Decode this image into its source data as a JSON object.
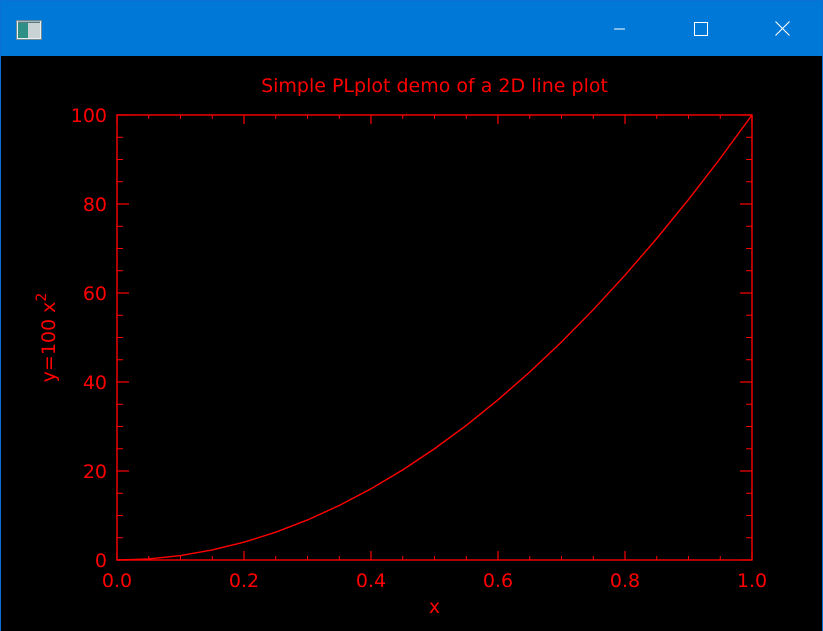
{
  "window": {
    "titlebar_color": "#0078d7",
    "icons": {
      "app": "app-window-icon",
      "minimize": "minimize-icon",
      "maximize": "maximize-icon",
      "close": "close-icon"
    }
  },
  "colors": {
    "plot_background": "#000000",
    "plot_foreground": "#ff0000"
  },
  "chart_data": {
    "type": "line",
    "title": "Simple PLplot demo of a 2D line plot",
    "xlabel": "x",
    "ylabel": "y=100 x",
    "ylabel_superscript": "2",
    "xlim": [
      0.0,
      1.0
    ],
    "ylim": [
      0,
      100
    ],
    "x_ticks": [
      "0.0",
      "0.2",
      "0.4",
      "0.6",
      "0.8",
      "1.0"
    ],
    "x_tick_values": [
      0.0,
      0.2,
      0.4,
      0.6,
      0.8,
      1.0
    ],
    "y_ticks": [
      "0",
      "20",
      "40",
      "60",
      "80",
      "100"
    ],
    "y_tick_values": [
      0,
      20,
      40,
      60,
      80,
      100
    ],
    "grid": false,
    "series": [
      {
        "x": [
          0.0,
          0.05,
          0.1,
          0.15,
          0.2,
          0.25,
          0.3,
          0.35,
          0.4,
          0.45,
          0.5,
          0.55,
          0.6,
          0.65,
          0.7,
          0.75,
          0.8,
          0.85,
          0.9,
          0.95,
          1.0
        ],
        "y": [
          0.0,
          0.25,
          1.0,
          2.25,
          4.0,
          6.25,
          9.0,
          12.25,
          16.0,
          20.25,
          25.0,
          30.25,
          36.0,
          42.25,
          49.0,
          56.25,
          64.0,
          72.25,
          81.0,
          90.25,
          100.0
        ]
      }
    ]
  }
}
